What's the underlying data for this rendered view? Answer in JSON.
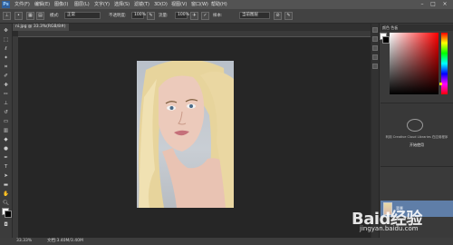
{
  "menubar": {
    "logo": "Ps",
    "items": [
      "文件(F)",
      "编辑(E)",
      "图像(I)",
      "图层(L)",
      "文字(Y)",
      "选择(S)",
      "滤镜(T)",
      "3D(D)",
      "视图(V)",
      "窗口(W)",
      "帮助(H)"
    ],
    "window_controls": [
      "–",
      "□",
      "×"
    ]
  },
  "options_bar": {
    "feather_label": "模式:",
    "mode_value": "正常",
    "opacity_label": "不透明度:",
    "opacity_value": "100%",
    "flow_label": "流量:",
    "flow_value": "100%",
    "sample_label": "样本:",
    "sample_value": "当前图层"
  },
  "document_tab": {
    "label": "ni.jpg @ 33.3%(RGB/8#)"
  },
  "status_bar": {
    "zoom": "33.33%",
    "doc_info": "文档:3.40M/3.40M"
  },
  "color_panel": {
    "title": "颜色  色板"
  },
  "cc_panel": {
    "line1": "利用 Creative Cloud Libraries 在应用程序",
    "line2": "开始使用"
  },
  "layers_panel": {
    "layer_name": "背景"
  },
  "watermark": {
    "text": "Baid经验",
    "sub": "jingyan.baidu.com"
  }
}
